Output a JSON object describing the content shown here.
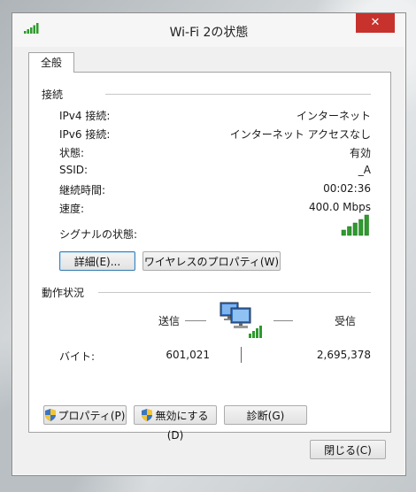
{
  "window": {
    "title": "Wi-Fi 2の状態",
    "close_glyph": "✕",
    "icon": "wifi-signal-icon"
  },
  "tabs": [
    {
      "label": "全般",
      "selected": true
    }
  ],
  "connection": {
    "section_label": "接続",
    "rows": [
      {
        "label": "IPv4 接続:",
        "value": "インターネット"
      },
      {
        "label": "IPv6 接続:",
        "value": "インターネット アクセスなし"
      },
      {
        "label": "状態:",
        "value": "有効"
      },
      {
        "label": "SSID:",
        "value": "_A"
      },
      {
        "label": "継続時間:",
        "value": "00:02:36"
      },
      {
        "label": "速度:",
        "value": "400.0 Mbps"
      }
    ],
    "signal_label": "シグナルの状態:",
    "signal_bars": 5,
    "signal_bars_max": 5,
    "details_button": "詳細(E)...",
    "wireless_props_button": "ワイヤレスのプロパティ(W)"
  },
  "activity": {
    "section_label": "動作状況",
    "sent_label": "送信",
    "received_label": "受信",
    "bytes_label": "バイト:",
    "bytes_sent": "601,021",
    "bytes_received": "2,695,378",
    "network_icon": "network-computers-icon"
  },
  "bottom_buttons": {
    "properties": "プロパティ(P)",
    "disable": "無効にする(D)",
    "diagnose": "診断(G)"
  },
  "close_button": "閉じる(C)",
  "colors": {
    "signal_green": "#2e9a2e",
    "close_red": "#c7322d",
    "focus_blue": "#3c7fb1"
  }
}
